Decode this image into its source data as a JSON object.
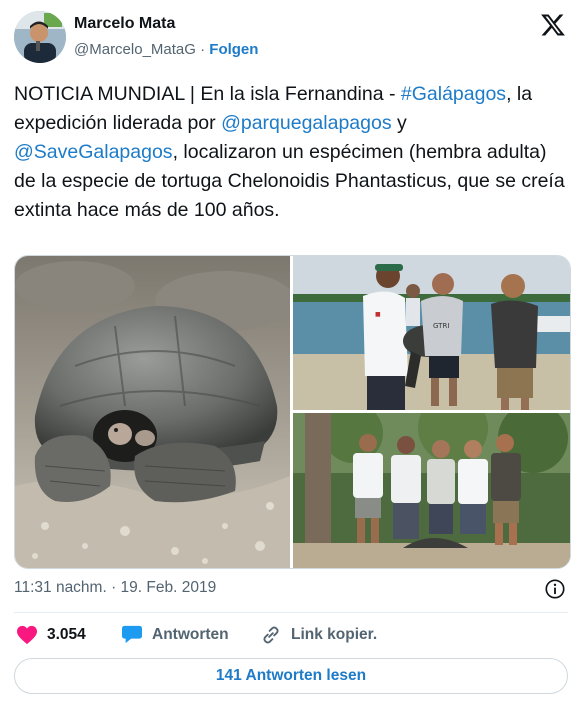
{
  "author": {
    "name": "Marcelo Mata",
    "handle": "@Marcelo_MataG",
    "separator": "·",
    "follow_label": "Folgen"
  },
  "tweet": {
    "text_1": "NOTICIA MUNDIAL | En la isla Fernandina - ",
    "hashtag": "#Galápagos",
    "text_2": ", la expedición liderada por ",
    "mention_1": "@parquegalapagos",
    "text_3": " y ",
    "mention_2": "@SaveGalapagos",
    "text_4": ", localizaron un espécimen (hembra adulta) de la especie de tortuga Chelonoidis Phantasticus, que se creía extinta hace más de 100 años."
  },
  "photo_texts": {
    "cap_logo": "GTRI"
  },
  "meta": {
    "timestamp": "11:31 nachm. · 19. Feb. 2019"
  },
  "actions": {
    "likes": "3.054",
    "reply_label": "Antworten",
    "copy_label": "Link kopier."
  },
  "read_replies_label": "141 Antworten lesen",
  "colors": {
    "link": "#1d7bc8",
    "heart": "#f91880",
    "reply": "#1d9bf0"
  }
}
